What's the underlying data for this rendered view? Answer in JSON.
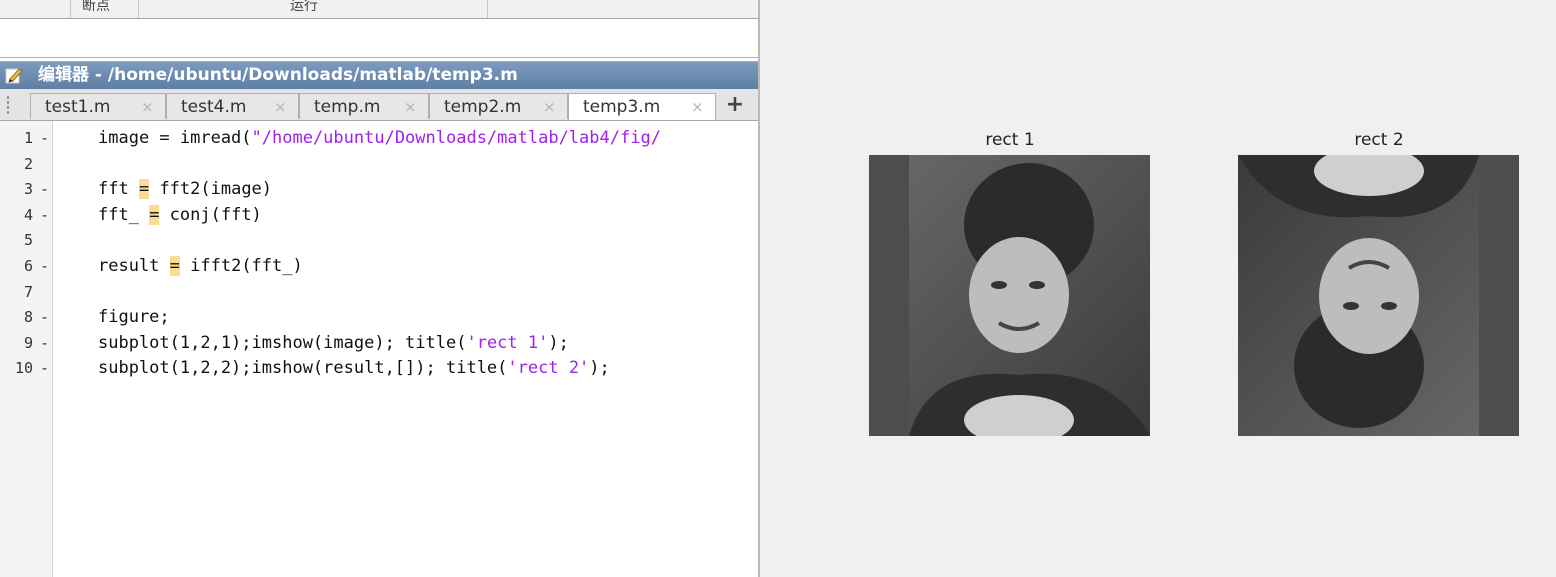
{
  "toolstrip": {
    "sections": [
      "断点",
      "运行"
    ]
  },
  "editor": {
    "title": "编辑器 - /home/ubuntu/Downloads/matlab/temp3.m",
    "icon": "edit-icon",
    "tabs": [
      {
        "label": "test1.m",
        "active": false
      },
      {
        "label": "test4.m",
        "active": false
      },
      {
        "label": "temp.m",
        "active": false
      },
      {
        "label": "temp2.m",
        "active": false
      },
      {
        "label": "temp3.m",
        "active": true
      }
    ],
    "tab_close_glyph": "×",
    "tab_add_glyph": "+",
    "lines": [
      {
        "num": "1",
        "dash": "-",
        "segs": [
          {
            "t": "image = imread("
          },
          {
            "t": "\"/home/ubuntu/Downloads/matlab/lab4/fig/",
            "c": "str"
          }
        ]
      },
      {
        "num": "2",
        "dash": "",
        "segs": []
      },
      {
        "num": "3",
        "dash": "-",
        "segs": [
          {
            "t": "fft "
          },
          {
            "t": "=",
            "c": "hl"
          },
          {
            "t": " fft2(image)"
          }
        ]
      },
      {
        "num": "4",
        "dash": "-",
        "segs": [
          {
            "t": "fft_ "
          },
          {
            "t": "=",
            "c": "hl"
          },
          {
            "t": " conj(fft)"
          }
        ]
      },
      {
        "num": "5",
        "dash": "",
        "segs": []
      },
      {
        "num": "6",
        "dash": "-",
        "segs": [
          {
            "t": "result "
          },
          {
            "t": "=",
            "c": "hl"
          },
          {
            "t": " ifft2(fft_)"
          }
        ]
      },
      {
        "num": "7",
        "dash": "",
        "segs": []
      },
      {
        "num": "8",
        "dash": "-",
        "segs": [
          {
            "t": "figure;"
          }
        ]
      },
      {
        "num": "9",
        "dash": "-",
        "segs": [
          {
            "t": "subplot(1,2,1);imshow(image); title("
          },
          {
            "t": "'rect 1'",
            "c": "str"
          },
          {
            "t": ");"
          }
        ]
      },
      {
        "num": "10",
        "dash": "-",
        "segs": [
          {
            "t": "subplot(1,2,2);imshow(result,[]); title("
          },
          {
            "t": "'rect 2'",
            "c": "str"
          },
          {
            "t": ");"
          }
        ]
      }
    ]
  },
  "figure": {
    "axes": [
      {
        "title": "rect 1",
        "content": "grayscale-portrait-woman"
      },
      {
        "title": "rect 2",
        "content": "grayscale-portrait-woman-rotated-180"
      }
    ]
  }
}
